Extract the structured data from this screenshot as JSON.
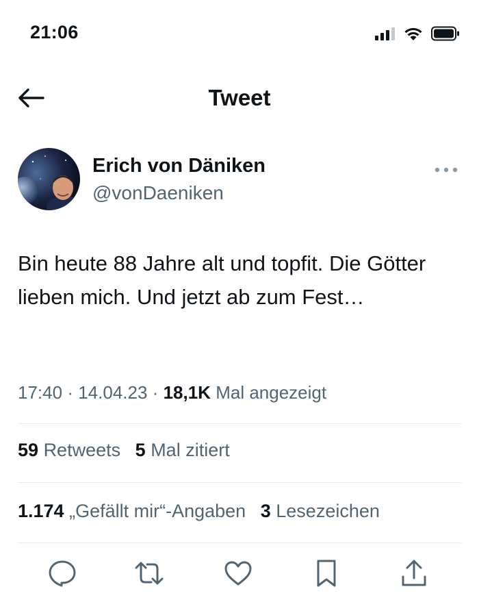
{
  "status_bar": {
    "time": "21:06",
    "icons": [
      "cellular-signal-icon",
      "wifi-icon",
      "battery-icon"
    ]
  },
  "header": {
    "title": "Tweet",
    "back_icon": "arrow-left-icon"
  },
  "author": {
    "name": "Erich von Däniken",
    "handle": "@vonDaeniken",
    "more_icon": "more-horizontal-icon"
  },
  "tweet": {
    "text": "Bin heute 88 Jahre alt und topfit. Die Götter lieben mich. Und jetzt ab zum Fest…"
  },
  "meta": {
    "time": "17:40",
    "separator": "·",
    "date": "14.04.23",
    "views_count": "18,1K",
    "views_label": "Mal angezeigt"
  },
  "stats": {
    "retweets_count": "59",
    "retweets_label": "Retweets",
    "quotes_count": "5",
    "quotes_label": "Mal zitiert",
    "likes_count": "1.174",
    "likes_label": "„Gefällt mir“-Angaben",
    "bookmarks_count": "3",
    "bookmarks_label": "Lesezeichen"
  },
  "actions": [
    "reply-icon",
    "retweet-icon",
    "like-icon",
    "bookmark-icon",
    "share-icon"
  ],
  "colors": {
    "text": "#0f1419",
    "secondary": "#536471",
    "divider": "#e6ecf0"
  }
}
